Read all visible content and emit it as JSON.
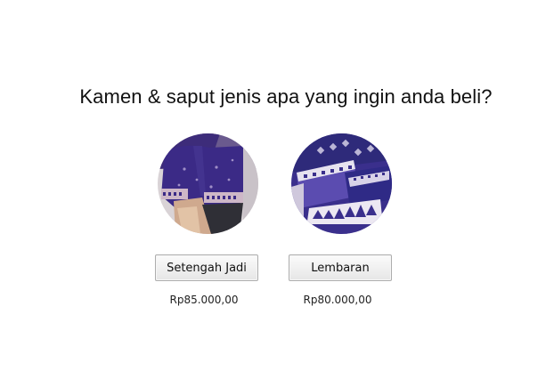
{
  "question": "Kamen & saput jenis apa yang ingin anda beli?",
  "options": [
    {
      "label": "Setengah Jadi",
      "price": "Rp85.000,00",
      "image": "purple-sarong-worn-photo"
    },
    {
      "label": "Lembaran",
      "price": "Rp80.000,00",
      "image": "folded-songket-cloth-photo"
    }
  ],
  "colors": {
    "background": "#ffffff",
    "text": "#111111",
    "button_border": "#adadad",
    "fabric_purple": "#3a2a8a"
  }
}
